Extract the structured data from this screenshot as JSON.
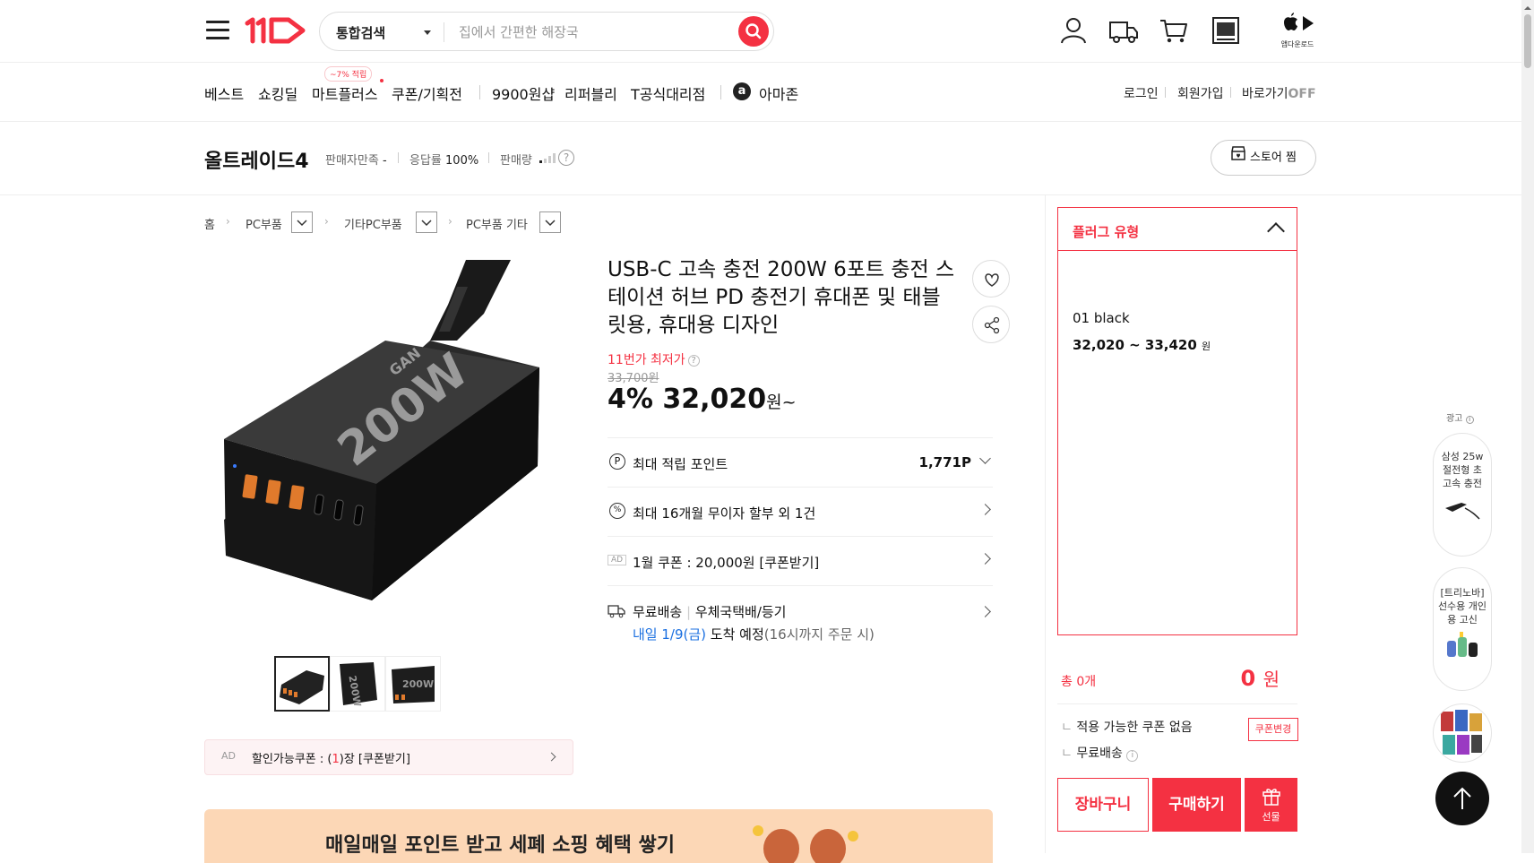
{
  "header": {
    "search_category": "통합검색",
    "search_placeholder": "집에서 간편한 해장국",
    "app_download": "앱다운로드"
  },
  "nav": {
    "items": [
      "베스트",
      "쇼킹딜",
      "마트플러스",
      "쿠폰/기획전",
      "9900원샵",
      "리퍼블리",
      "T공식대리점",
      "아마존"
    ],
    "mart_badge": "~7% 적립",
    "login": "로그인",
    "signup": "회원가입",
    "shortcut": "바로가기",
    "shortcut_state": "OFF"
  },
  "seller": {
    "name": "올트레이드4",
    "satisfaction_label": "판매자만족",
    "satisfaction_value": "-",
    "response_label": "응답률",
    "response_value": "100%",
    "sales_label": "판매량",
    "store_button": "스토어 찜"
  },
  "breadcrumb": [
    "홈",
    "PC부품",
    "기타PC부품",
    "PC부품 기타"
  ],
  "product": {
    "title": "USB-C 고속 충전 200W 6포트 충전 스테이션 허브 PD 충전기 휴대폰 및 태블릿용, 휴대용 디자인",
    "lowest_label": "11번가 최저가",
    "original_price": "33,700원",
    "discount": "4%",
    "price": "32,020",
    "price_unit": "원~",
    "image_text": "200W",
    "image_subtext": "GAN"
  },
  "benefits": {
    "points_label": "최대 적립 포인트",
    "points_value": "1,771P",
    "installment": "최대 16개월 무이자 할부 외 1건",
    "coupon_ad": "AD",
    "coupon_text": "1월 쿠폰 : 20,000원 [쿠폰받기]",
    "delivery_free": "무료배송",
    "delivery_method": "우체국택배/등기",
    "arrival_day": "내일 1/9(금)",
    "arrival_text": "도착 예정",
    "arrival_note": "(16시까지 주문 시)"
  },
  "coupon_bar": {
    "ad": "AD",
    "text_prefix": "할인가능쿠폰 : (",
    "count": "1",
    "text_suffix": ")장 [쿠폰받기]"
  },
  "banner": {
    "text": "매일매일 포인트 받고 세폐 소핑 혜택 쌓기"
  },
  "options": {
    "header": "플러그 유형",
    "item_name": "01 black",
    "item_price": "32,020 ~ 33,420",
    "item_unit": "원"
  },
  "order": {
    "total_label": "총 0개",
    "total_price": "0",
    "total_unit": "원",
    "coupon_none": "적용 가능한 쿠폰 없음",
    "coupon_change": "쿠폰변경",
    "free_shipping": "무료배송",
    "cart": "장바구니",
    "buy": "구매하기",
    "gift": "선물"
  },
  "side": {
    "ad_label": "광고",
    "card1": "삼성 25w 절전형 초고속 충전",
    "card2": "[트리노바] 선수용 개인용 고신"
  },
  "colors": {
    "brand": "#f43142",
    "link": "#1a6fe0"
  }
}
